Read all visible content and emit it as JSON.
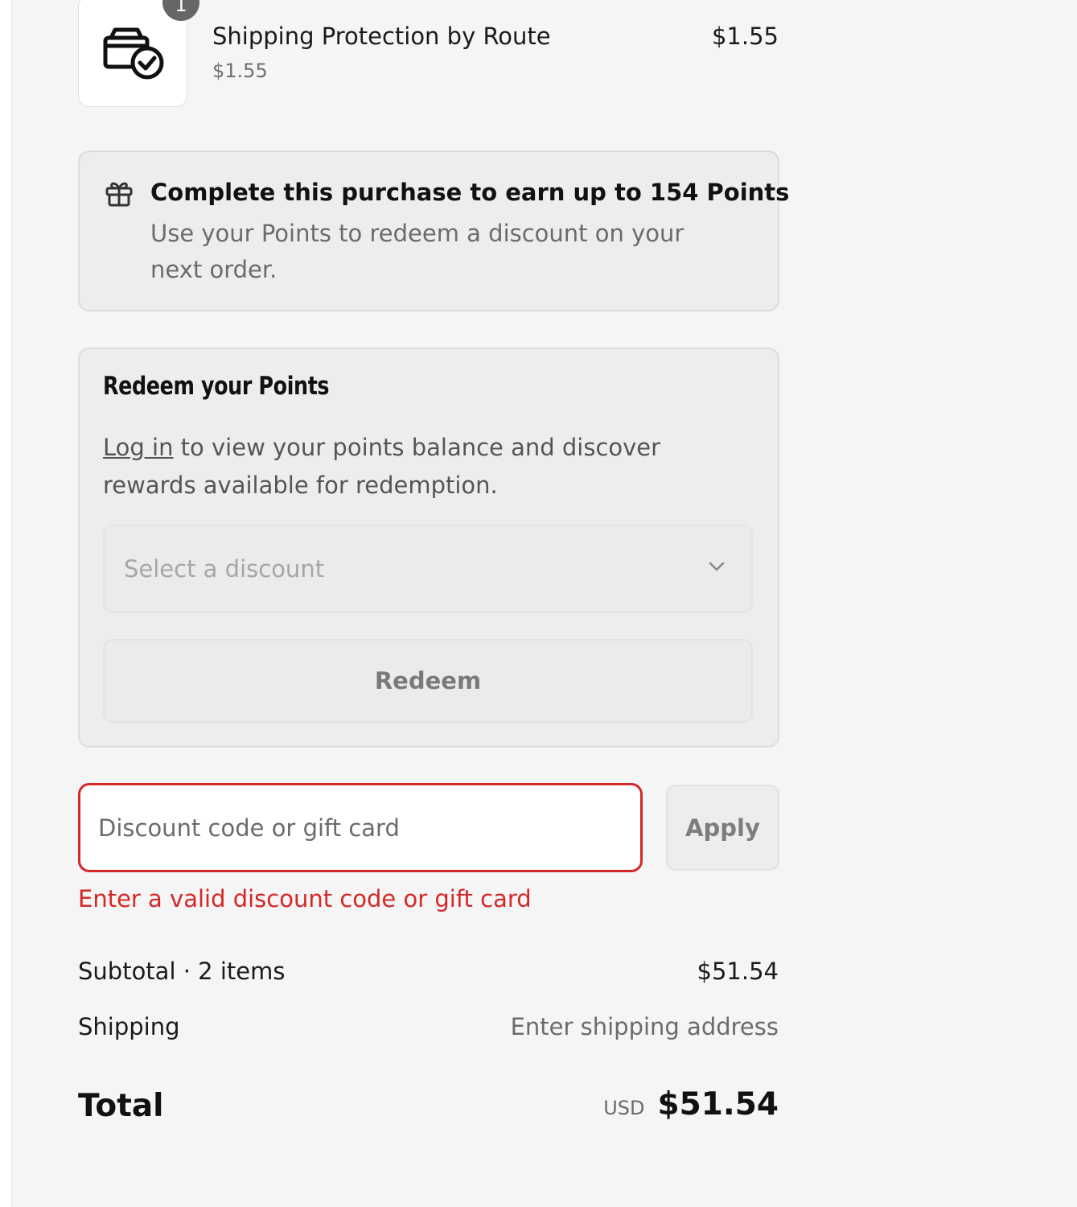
{
  "line_item": {
    "quantity": "1",
    "name": "Shipping Protection by Route",
    "unit_price": "$1.55",
    "price": "$1.55",
    "icon": "package-check-icon"
  },
  "points_banner": {
    "icon": "gift-icon",
    "title": "Complete this purchase to earn up to 154 Points",
    "text": "Use your Points to redeem a discount on your next order."
  },
  "redeem": {
    "title": "Redeem your Points",
    "login_link": "Log in",
    "text": " to view your points balance and discover rewards available for redemption.",
    "select_placeholder": "Select a discount",
    "button": "Redeem"
  },
  "discount": {
    "placeholder": "Discount code or gift card",
    "apply": "Apply",
    "error": "Enter a valid discount code or gift card",
    "error_color": "#d42828"
  },
  "summary": {
    "subtotal_label": "Subtotal · 2 items",
    "subtotal_value": "$51.54",
    "shipping_label": "Shipping",
    "shipping_value": "Enter shipping address",
    "total_label": "Total",
    "currency": "USD",
    "total_value": "$51.54"
  }
}
